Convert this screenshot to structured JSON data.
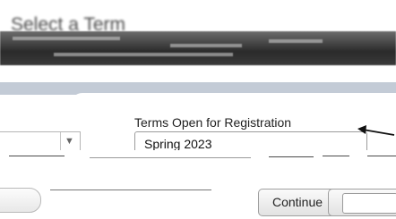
{
  "page": {
    "heading": "Select a Term"
  },
  "term_form": {
    "label": "Terms Open for Registration",
    "selected_term": "Spring 2023"
  },
  "actions": {
    "continue_label": "Continue"
  },
  "colors": {
    "subbar": "#c3cbd6",
    "arrow": "#111111"
  }
}
